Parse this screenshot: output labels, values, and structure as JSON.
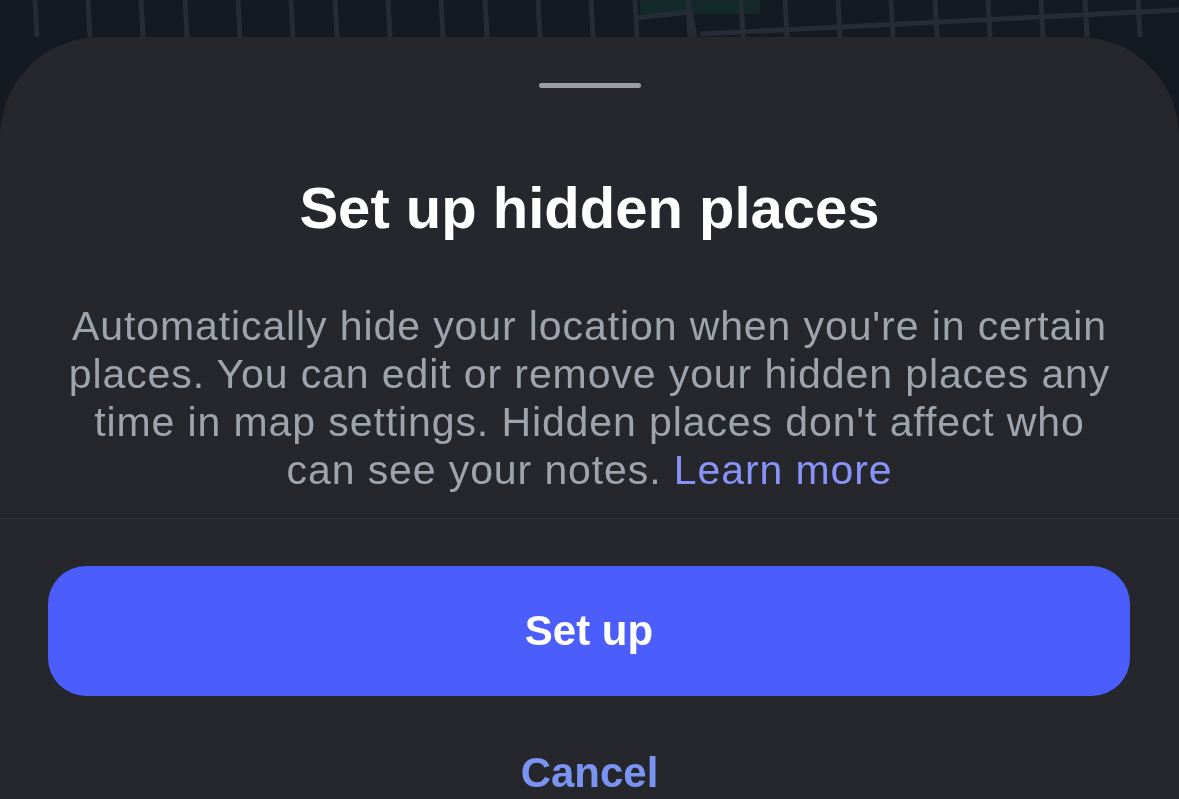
{
  "sheet": {
    "title": "Set up hidden places",
    "description": "Automatically hide your location when you're in certain places. You can edit or remove your hidden places any time in map settings. Hidden places don't affect who can see your notes.",
    "link": "Learn more",
    "primary_button": "Set up",
    "cancel_button": "Cancel"
  }
}
